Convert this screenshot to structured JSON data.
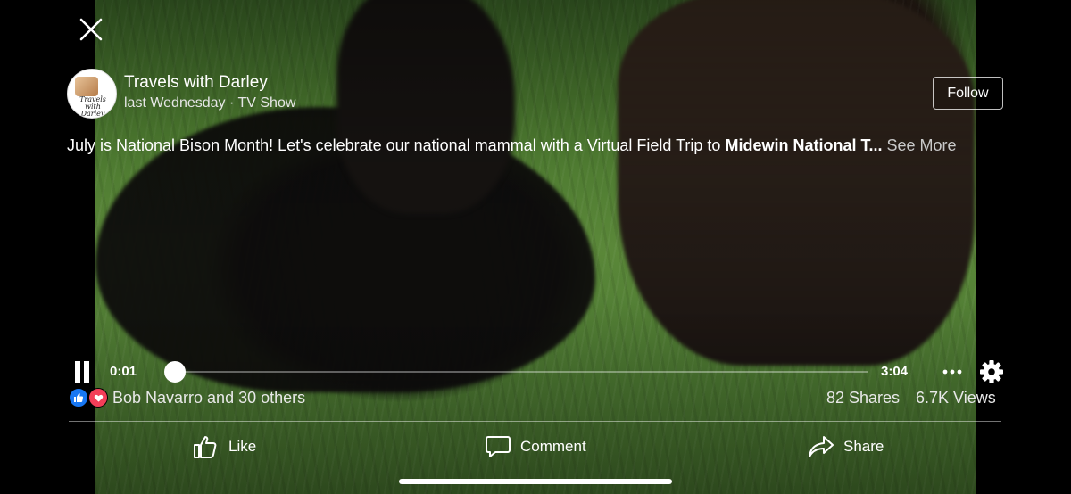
{
  "header": {
    "page_name": "Travels with Darley",
    "post_meta": "last Wednesday · TV Show",
    "follow_label": "Follow",
    "avatar_brand": "Travels with Darley"
  },
  "caption": {
    "text_prefix": "July is National Bison Month! Let's celebrate our national mammal with a Virtual Field Trip to ",
    "bold_text": "Midewin National T...",
    "see_more": "See More"
  },
  "player": {
    "current_time": "0:01",
    "total_time": "3:04",
    "progress_fraction": 0.005
  },
  "engagement": {
    "reactors": "Bob Navarro and 30 others",
    "shares": "82 Shares",
    "views": "6.7K Views",
    "reaction_icons": [
      "like-reaction-icon",
      "love-reaction-icon"
    ]
  },
  "actions": {
    "like": "Like",
    "comment": "Comment",
    "share": "Share"
  },
  "colors": {
    "like_blue": "#1877f2",
    "love_red": "#f33e58"
  }
}
